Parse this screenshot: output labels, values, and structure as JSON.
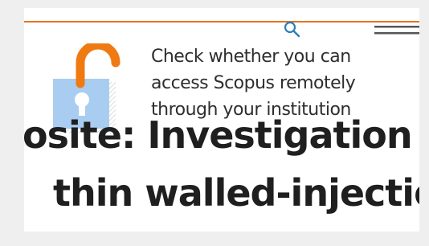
{
  "header": {
    "accent_color": "#e9711c",
    "search_icon": "search-icon",
    "menu_icon": "hamburger-menu-icon"
  },
  "promo": {
    "icon": "unlocked-padlock-icon",
    "text": "Check whether you can access Scopus remotely through your institution"
  },
  "article": {
    "title_line_1": "osite: Investigation of",
    "title_line_2": "thin walled-injection"
  }
}
